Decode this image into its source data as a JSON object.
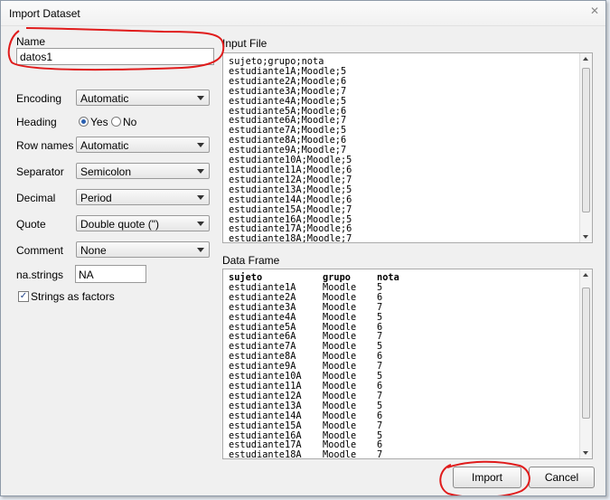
{
  "window": {
    "title": "Import Dataset",
    "close_glyph": "✕"
  },
  "name": {
    "label": "Name",
    "value": "datos1"
  },
  "options": {
    "encoding": {
      "label": "Encoding",
      "value": "Automatic"
    },
    "heading": {
      "label": "Heading",
      "yes": "Yes",
      "no": "No",
      "selected": "Yes"
    },
    "row_names": {
      "label": "Row names",
      "value": "Automatic"
    },
    "separator": {
      "label": "Separator",
      "value": "Semicolon"
    },
    "decimal": {
      "label": "Decimal",
      "value": "Period"
    },
    "quote": {
      "label": "Quote",
      "value": "Double quote (\")"
    },
    "comment": {
      "label": "Comment",
      "value": "None"
    },
    "na_strings": {
      "label": "na.strings",
      "value": "NA"
    },
    "strings_as_factors": {
      "label": "Strings as factors",
      "checked": true
    }
  },
  "input_file": {
    "label": "Input File",
    "lines": [
      "sujeto;grupo;nota",
      "estudiante1A;Moodle;5",
      "estudiante2A;Moodle;6",
      "estudiante3A;Moodle;7",
      "estudiante4A;Moodle;5",
      "estudiante5A;Moodle;6",
      "estudiante6A;Moodle;7",
      "estudiante7A;Moodle;5",
      "estudiante8A;Moodle;6",
      "estudiante9A;Moodle;7",
      "estudiante10A;Moodle;5",
      "estudiante11A;Moodle;6",
      "estudiante12A;Moodle;7",
      "estudiante13A;Moodle;5",
      "estudiante14A;Moodle;6",
      "estudiante15A;Moodle;7",
      "estudiante16A;Moodle;5",
      "estudiante17A;Moodle;6",
      "estudiante18A;Moodle;7"
    ]
  },
  "data_frame": {
    "label": "Data Frame",
    "columns": [
      "sujeto",
      "grupo",
      "nota"
    ],
    "rows": [
      [
        "estudiante1A",
        "Moodle",
        "5"
      ],
      [
        "estudiante2A",
        "Moodle",
        "6"
      ],
      [
        "estudiante3A",
        "Moodle",
        "7"
      ],
      [
        "estudiante4A",
        "Moodle",
        "5"
      ],
      [
        "estudiante5A",
        "Moodle",
        "6"
      ],
      [
        "estudiante6A",
        "Moodle",
        "7"
      ],
      [
        "estudiante7A",
        "Moodle",
        "5"
      ],
      [
        "estudiante8A",
        "Moodle",
        "6"
      ],
      [
        "estudiante9A",
        "Moodle",
        "7"
      ],
      [
        "estudiante10A",
        "Moodle",
        "5"
      ],
      [
        "estudiante11A",
        "Moodle",
        "6"
      ],
      [
        "estudiante12A",
        "Moodle",
        "7"
      ],
      [
        "estudiante13A",
        "Moodle",
        "5"
      ],
      [
        "estudiante14A",
        "Moodle",
        "6"
      ],
      [
        "estudiante15A",
        "Moodle",
        "7"
      ],
      [
        "estudiante16A",
        "Moodle",
        "5"
      ],
      [
        "estudiante17A",
        "Moodle",
        "6"
      ],
      [
        "estudiante18A",
        "Moodle",
        "7"
      ]
    ]
  },
  "buttons": {
    "import": "Import",
    "cancel": "Cancel"
  },
  "annotation_color": "#e01b1b"
}
